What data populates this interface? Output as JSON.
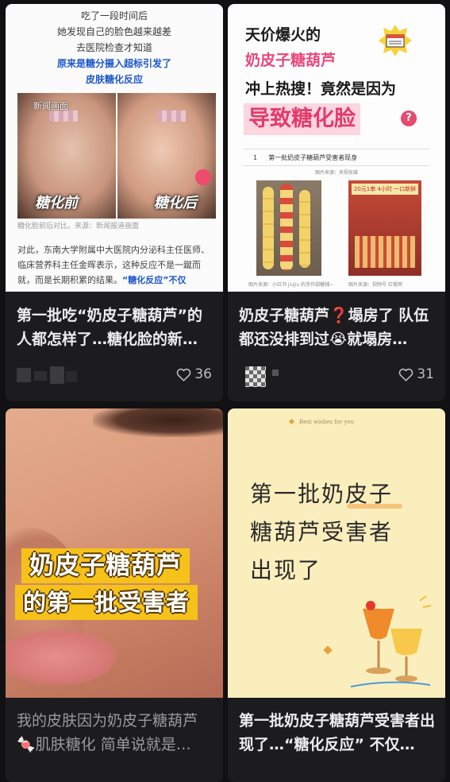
{
  "cards": [
    {
      "title": "第一批吃“奶皮子糖葫芦”的人都怎样了…糖化脸的新…",
      "likes": "36",
      "thumb": {
        "lines": [
          "吃了一段时间后",
          "她发现自己的脸色越来越差",
          "去医院检查才知道",
          "原来是糖分摄入超标引发了",
          "皮肤糖化反应"
        ],
        "news_label": "新闻画面",
        "before_label": "糖化前",
        "after_label": "糖化后",
        "caption": "糖化脸前后对比。来源：新闻报道画面",
        "para": "对此，东南大学附属中大医院内分泌科主任医师、临床营养科主任金晖表示，这种反应不是一蹴而就，而是长期积累的结果。",
        "para_highlight": "“糖化反应”不仅"
      }
    },
    {
      "title": "奶皮子糖葫芦❓塌房了 队伍都还没排到过😭就塌房…",
      "likes": "31",
      "thumb": {
        "line1": "天价爆火的",
        "line2": "奶皮子糖葫芦",
        "line3": "冲上热搜！竟然是因为",
        "highlight": "导致糖化脸",
        "sub_num": "1",
        "sub_text": "第一批奶皮子糖葫芦受害者现身",
        "src_top": "图片来源：央视官媒",
        "src_left": "图片来源：小红书 jiujiu 的手作甜糖铺~",
        "src_right": "图片来源：视频号 红餐网",
        "price_tag": "20元1串 4小时 一口新鲜"
      }
    },
    {
      "title": "我的皮肤因为奶皮子糖葫芦🍬肌肤糖化 简单说就是…",
      "thumb": {
        "band1": "奶皮子糖葫芦",
        "band2": "的第一批受害者"
      }
    },
    {
      "title": "第一批奶皮子糖葫芦受害者出现了…“糖化反应” 不仅…",
      "thumb": {
        "small": "Best wishes for you",
        "line1": "第一批奶皮子",
        "line2": "糖葫芦受害者",
        "line3": "出现了"
      }
    }
  ],
  "icons": {
    "heart": "heart-outline-icon"
  },
  "colors": {
    "background": "#111113",
    "card": "#1c1c1f",
    "accent_pink": "#e23b6b",
    "accent_blue": "#1d57c9",
    "band_yellow": "#f6c21a"
  }
}
